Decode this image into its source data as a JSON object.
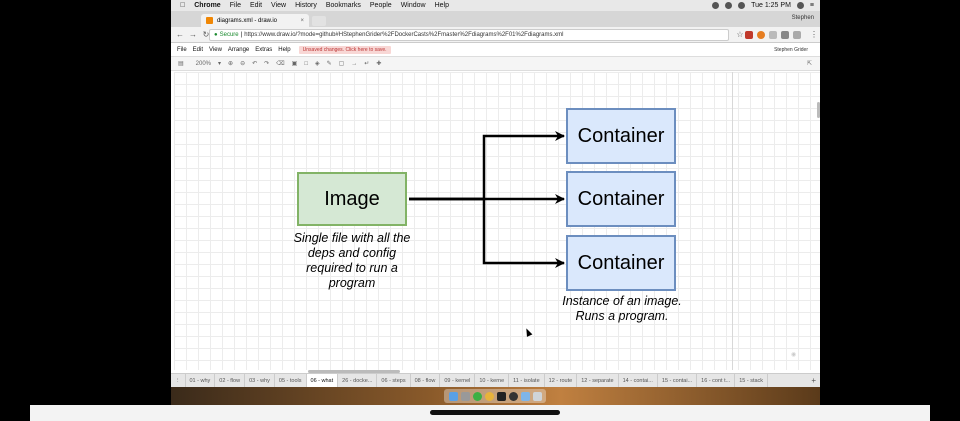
{
  "menubar": {
    "apple": "",
    "items": [
      "Chrome",
      "File",
      "Edit",
      "View",
      "History",
      "Bookmarks",
      "People",
      "Window",
      "Help"
    ],
    "clock": "Tue 1:25 PM"
  },
  "browser": {
    "tab_title": "diagrams.xml - draw.io",
    "tab_close": "×",
    "profile": "Stephen",
    "secure_label": "Secure",
    "url": "https://www.draw.io/?mode=github#HStephenGrider%2FDockerCasts%2Fmaster%2Fdiagrams%2F01%2Fdiagrams.xml"
  },
  "drawio": {
    "menu": [
      "File",
      "Edit",
      "View",
      "Arrange",
      "Extras",
      "Help"
    ],
    "unsaved": "Unsaved changes. Click here to save.",
    "user": "Stephen Grider",
    "zoom": "200%"
  },
  "diagram": {
    "image_label": "Image",
    "image_caption": "Single file with all the deps and config required to run a program",
    "containers": [
      "Container",
      "Container",
      "Container"
    ],
    "container_caption": "Instance of an image. Runs a program."
  },
  "pages": [
    "01 - why",
    "02 - flow",
    "03 - why",
    "05 - tools",
    "06 - what",
    "26 - docke...",
    "06 - steps",
    "08 - flow",
    "09 - kernel",
    "10 - kerne",
    "11 - isolate",
    "12 - route",
    "12 - separate",
    "14 - contai...",
    "15 - contai...",
    "16 - cont t...",
    "15 - stack"
  ],
  "active_page_index": 4,
  "colors": {
    "image_fill": "#d5e8d4",
    "image_stroke": "#82b366",
    "container_fill": "#dae8fc",
    "container_stroke": "#6c8ebf"
  }
}
